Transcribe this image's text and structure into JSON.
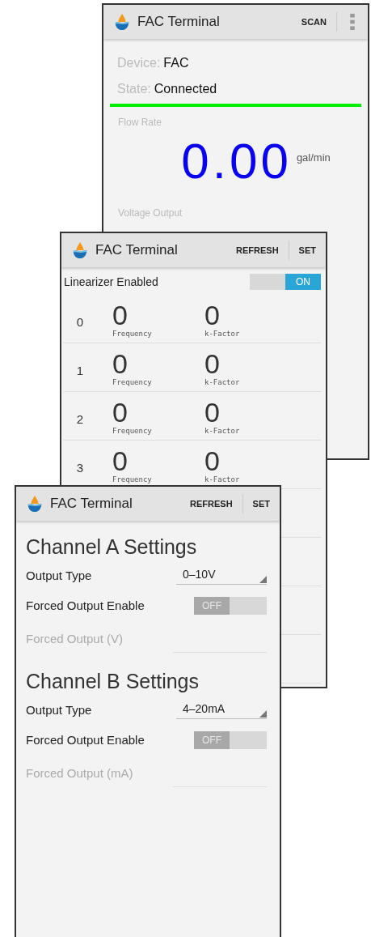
{
  "screens": [
    {
      "kind": "status",
      "title": "FAC Terminal",
      "actions": [
        "SCAN"
      ],
      "device_label": "Device:",
      "device_value": "FAC",
      "state_label": "State:",
      "state_value": "Connected",
      "connected": true,
      "flow_label": "Flow Rate",
      "flow_value": "0.00",
      "flow_unit": "gal/min",
      "voltage_label": "Voltage Output"
    },
    {
      "kind": "linearizer",
      "title": "FAC Terminal",
      "actions": [
        "REFRESH",
        "SET"
      ],
      "toggle_label": "Linearizer Enabled",
      "toggle": {
        "on": true,
        "label": "ON"
      },
      "rows": [
        {
          "index": "0",
          "frequency": "0",
          "frequency_label": "Frequency",
          "kfactor": "0",
          "kfactor_label": "k-Factor"
        },
        {
          "index": "1",
          "frequency": "0",
          "frequency_label": "Frequency",
          "kfactor": "0",
          "kfactor_label": "k-Factor"
        },
        {
          "index": "2",
          "frequency": "0",
          "frequency_label": "Frequency",
          "kfactor": "0",
          "kfactor_label": "k-Factor"
        },
        {
          "index": "3",
          "frequency": "0",
          "frequency_label": "Frequency",
          "kfactor": "0",
          "kfactor_label": "k-Factor"
        }
      ]
    },
    {
      "kind": "settings",
      "title": "FAC Terminal",
      "actions": [
        "REFRESH",
        "SET"
      ],
      "channels": [
        {
          "heading": "Channel A Settings",
          "output_type_label": "Output Type",
          "output_type_value": "0–10V",
          "forced_enable_label": "Forced Output Enable",
          "forced_enable": {
            "on": false,
            "label": "OFF"
          },
          "forced_output_label": "Forced Output (V)",
          "forced_output_disabled": true
        },
        {
          "heading": "Channel B Settings",
          "output_type_label": "Output Type",
          "output_type_value": "4–20mA",
          "forced_enable_label": "Forced Output Enable",
          "forced_enable": {
            "on": false,
            "label": "OFF"
          },
          "forced_output_label": "Forced Output (mA)",
          "forced_output_disabled": true
        }
      ]
    }
  ]
}
